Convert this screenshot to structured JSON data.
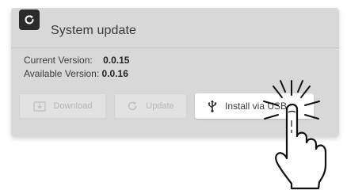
{
  "dialog": {
    "title": "System update",
    "title_icon": "refresh-icon"
  },
  "versions": {
    "current_label": "Current Version:",
    "current_value": "0.0.15",
    "available_label": "Available Version:",
    "available_value": "0.0.16"
  },
  "buttons": {
    "download_label": "Download",
    "download_icon": "download-icon",
    "update_label": "Update",
    "update_icon": "refresh-icon",
    "usb_label": "Install via USB",
    "usb_icon": "usb-icon"
  },
  "overlay": {
    "pointer_icon": "tap-hand-icon"
  },
  "colors": {
    "panel_bg": "#d8d8d8",
    "badge_bg": "#2b2b2b",
    "disabled_text": "#b6b6b6",
    "primary_bg": "#ffffff"
  }
}
